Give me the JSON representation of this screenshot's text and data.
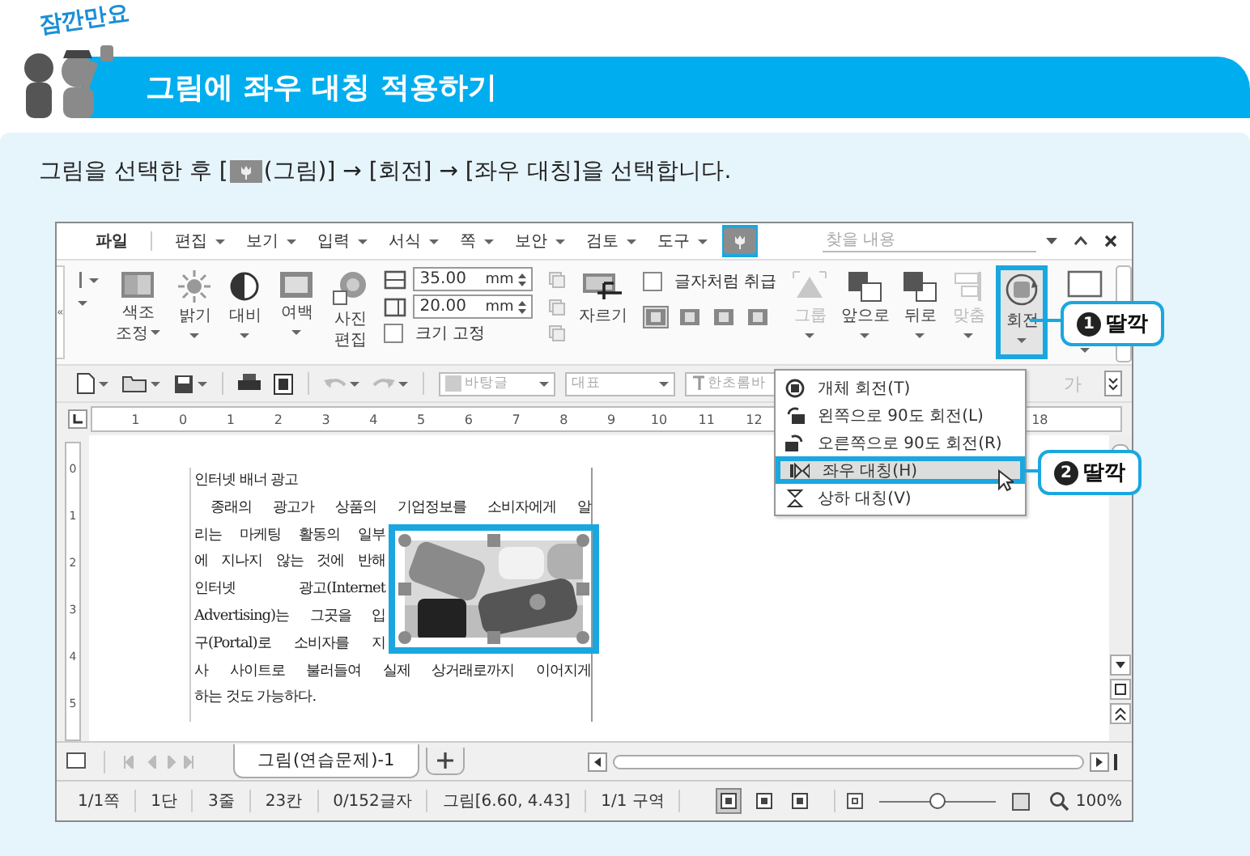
{
  "badge": "잠깐만요",
  "title": "그림에 좌우 대칭 적용하기",
  "instruction": {
    "before": "그림을 선택한 후 [",
    "after": "(그림)] → [회전] → [좌우 대칭]을 선택합니다."
  },
  "menu_bar": {
    "items": [
      {
        "label": "파일",
        "dropdown": false
      },
      {
        "label": "편집",
        "dropdown": true
      },
      {
        "label": "보기",
        "dropdown": true
      },
      {
        "label": "입력",
        "dropdown": true
      },
      {
        "label": "서식",
        "dropdown": true
      },
      {
        "label": "쪽",
        "dropdown": true
      },
      {
        "label": "보안",
        "dropdown": true
      },
      {
        "label": "검토",
        "dropdown": true
      },
      {
        "label": "도구",
        "dropdown": true
      }
    ],
    "picture_tab": {
      "selected": true,
      "highlighted": true
    },
    "search": {
      "placeholder": "찾을 내용"
    }
  },
  "ribbon": {
    "collapse": "«",
    "image_buttons": [
      {
        "label": "색조\n조정",
        "dropdown": true
      },
      {
        "label": "밝기",
        "dropdown": true
      },
      {
        "label": "대비",
        "dropdown": true
      },
      {
        "label": "여백",
        "dropdown": true
      },
      {
        "label": "사진\n편집",
        "dropdown": false
      }
    ],
    "sizes": [
      {
        "value": "35.00",
        "unit": "mm"
      },
      {
        "value": "20.00",
        "unit": "mm"
      }
    ],
    "lock_size": {
      "label": "크기 고정",
      "checked": false
    },
    "crop": {
      "label": "자르기"
    },
    "treat_as_char": {
      "label": "글자처럼 취급",
      "checked": false
    },
    "wrap_modes": [
      {
        "selected": true
      },
      {
        "selected": false
      },
      {
        "selected": false
      },
      {
        "selected": false
      }
    ],
    "arrange_buttons": [
      {
        "label": "그룹",
        "disabled": true,
        "highlighted": false
      },
      {
        "label": "앞으로",
        "disabled": false,
        "highlighted": false
      },
      {
        "label": "뒤로",
        "disabled": false,
        "highlighted": false
      },
      {
        "label": "맞춤",
        "disabled": true,
        "highlighted": false
      },
      {
        "label": "회전",
        "disabled": false,
        "highlighted": true
      }
    ]
  },
  "toolbar": {
    "style": "바탕글",
    "outline": "대표",
    "font": "한초롬바",
    "letter": "가"
  },
  "ruler": {
    "marks": [
      "1",
      "0",
      "1",
      "2",
      "3",
      "4",
      "5",
      "6",
      "7",
      "8",
      "9",
      "10",
      "11",
      "12"
    ],
    "end": [
      "18"
    ]
  },
  "vertical_ruler": [
    "0",
    "1",
    "2",
    "3",
    "4",
    "5"
  ],
  "document": {
    "lines": [
      {
        "text": "인터넷 배너 광고",
        "kind": "plain"
      },
      {
        "text": "종래의 광고가 상품의 기업정보를 소비자에게 알",
        "kind": "indent"
      },
      {
        "text": "리는 마케팅 활동의 일부",
        "kind": "partial"
      },
      {
        "text": "에 지나지 않는 것에 반해",
        "kind": "partial"
      },
      {
        "text": "인터넷 광고(Internet",
        "kind": "partial"
      },
      {
        "text": "Advertising)는 그곳을 입",
        "kind": "partial"
      },
      {
        "text": "구(Portal)로 소비자를 지",
        "kind": "partial"
      },
      {
        "text": "사 사이트로 불러들여 실제 상거래로까지 이어지게",
        "kind": "full"
      },
      {
        "text": "하는 것도 가능하다.",
        "kind": "plain"
      }
    ],
    "picture": {
      "kind": "picture",
      "highlighted": true
    }
  },
  "context_menu": {
    "items": [
      {
        "label": "개체 회전(T)",
        "selected": false,
        "highlighted": false
      },
      {
        "label": "왼쪽으로 90도 회전(L)",
        "selected": false,
        "highlighted": false
      },
      {
        "label": "오른쪽으로 90도 회전(R)",
        "selected": false,
        "highlighted": false
      },
      {
        "label": "좌우 대칭(H)",
        "selected": true,
        "highlighted": true
      },
      {
        "label": "상하 대칭(V)",
        "selected": false,
        "highlighted": false
      }
    ]
  },
  "callouts": [
    {
      "number": "1",
      "text": "딸깍"
    },
    {
      "number": "2",
      "text": "딸깍"
    }
  ],
  "sheet_tabs": [
    {
      "label": "그림(연습문제)-1",
      "selected": true
    }
  ],
  "status_bar": {
    "fields": [
      "1/1쪽",
      "1단",
      "3줄",
      "23칸",
      "0/152글자",
      "그림[6.60, 4.43]",
      "1/1 구역"
    ],
    "views": [
      {
        "selected": true
      },
      {
        "selected": false
      },
      {
        "selected": false
      }
    ],
    "zoom": {
      "level": 0.5,
      "reading": "100%"
    }
  }
}
